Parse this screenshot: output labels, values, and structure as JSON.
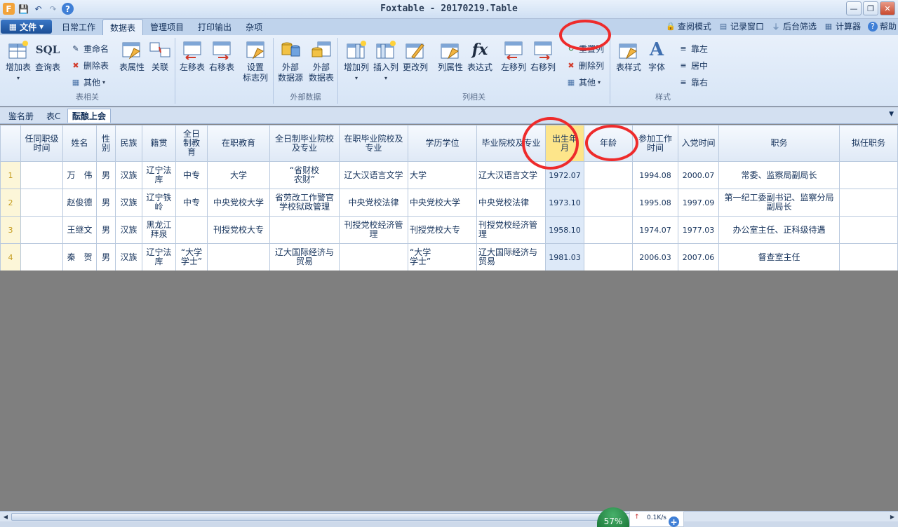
{
  "window": {
    "title": "Foxtable - 20170219.Table",
    "min": "—",
    "restore": "❐",
    "close": "✕"
  },
  "qat": {
    "app": "F",
    "save": "💾",
    "undo": "↶",
    "redo": "↷",
    "help": "?"
  },
  "file_menu": {
    "label": "文件",
    "icon": "▦",
    "arrow": "▾"
  },
  "tabs": [
    "日常工作",
    "数据表",
    "管理项目",
    "打印输出",
    "杂项"
  ],
  "right_links": [
    {
      "label": "查阅模式",
      "icon": "🔒"
    },
    {
      "label": "记录窗口",
      "icon": "▤"
    },
    {
      "label": "后台筛选",
      "icon": "⏚"
    },
    {
      "label": "计算器",
      "icon": "▦"
    },
    {
      "label": "帮助",
      "icon": "?"
    }
  ],
  "ribbon": {
    "table_group": {
      "label": "表相关",
      "add_table": "增加表",
      "query_table": "查询表",
      "sql": "SQL",
      "rename": "重命名",
      "delete_table": "删除表",
      "other": "其他",
      "table_props": "表属性",
      "relation": "关联",
      "move_left": "左移表",
      "move_right": "右移表",
      "set_flag_col_1": "设置",
      "set_flag_col_2": "标志列"
    },
    "external_group": {
      "label": "外部数据",
      "ext_source_1": "外部",
      "ext_source_2": "数据源",
      "ext_table_1": "外部",
      "ext_table_2": "数据表"
    },
    "column_group": {
      "label": "列相关",
      "add_col": "增加列",
      "insert_col": "插入列",
      "change_col": "更改列",
      "col_props": "列属性",
      "expr": "表达式",
      "fx": "fx",
      "col_left": "左移列",
      "col_right": "右移列",
      "reset_col": "重置列",
      "delete_col": "删除列",
      "other": "其他"
    },
    "style_group": {
      "label": "样式",
      "table_style": "表样式",
      "font": "字体",
      "font_glyph": "A",
      "align_left": "靠左",
      "align_center": "居中",
      "align_right": "靠右"
    }
  },
  "sheet_tabs": [
    "鉴名册",
    "表C",
    "酝酿上会"
  ],
  "grid": {
    "headers": [
      "任同职级\n时间",
      "姓名",
      "性\n别",
      "民族",
      "籍贯",
      "全日\n制教\n育",
      "在职教育",
      "全日制毕业院校\n及专业",
      "在职毕业院校及\n专业",
      "学历学位",
      "毕业院校及专业",
      "出生年\n月",
      "年龄",
      "参加工作\n时间",
      "入党时间",
      "职务",
      "拟任职务"
    ],
    "rows": [
      {
        "n": "1",
        "cells": [
          "",
          "万　伟",
          "男",
          "汉族",
          "辽宁法\n库",
          "中专",
          "大学",
          "“省财校\n农财”",
          "辽大汉语言文学",
          "大学",
          "辽大汉语言文学",
          "1972.07",
          "",
          "1994.08",
          "2000.07",
          "常委、监察局副局长",
          ""
        ]
      },
      {
        "n": "2",
        "cells": [
          "",
          "赵俊德",
          "男",
          "汉族",
          "辽宁铁\n岭",
          "中专",
          "中央党校大学",
          "省劳改工作警官\n学校狱政管理",
          "中央党校法律",
          "中央党校大学",
          "中央党校法律",
          "1973.10",
          "",
          "1995.08",
          "1997.09",
          "第一纪工委副书记、监察分局\n副局长",
          ""
        ]
      },
      {
        "n": "3",
        "cells": [
          "",
          "王继文",
          "男",
          "汉族",
          "黑龙江\n拜泉",
          "",
          "刊授党校大专",
          "",
          "刊授党校经济管\n理",
          "刊授党校大专",
          "刊授党校经济管\n理",
          "1958.10",
          "",
          "1974.07",
          "1977.03",
          "办公室主任、正科级待遇",
          ""
        ]
      },
      {
        "n": "4",
        "cells": [
          "",
          "秦　贺",
          "男",
          "汉族",
          "辽宁法\n库",
          "“大学\n学士”",
          "",
          "辽大国际经济与\n贸易",
          "",
          "“大学\n学士”",
          "辽大国际经济与\n贸易",
          "1981.03",
          "",
          "2006.03",
          "2007.06",
          "督查室主任",
          ""
        ]
      }
    ]
  },
  "status": {
    "net_percent": "57%",
    "net_speed": "0.1K/s",
    "arrow_up": "↑",
    "plus": "+"
  }
}
